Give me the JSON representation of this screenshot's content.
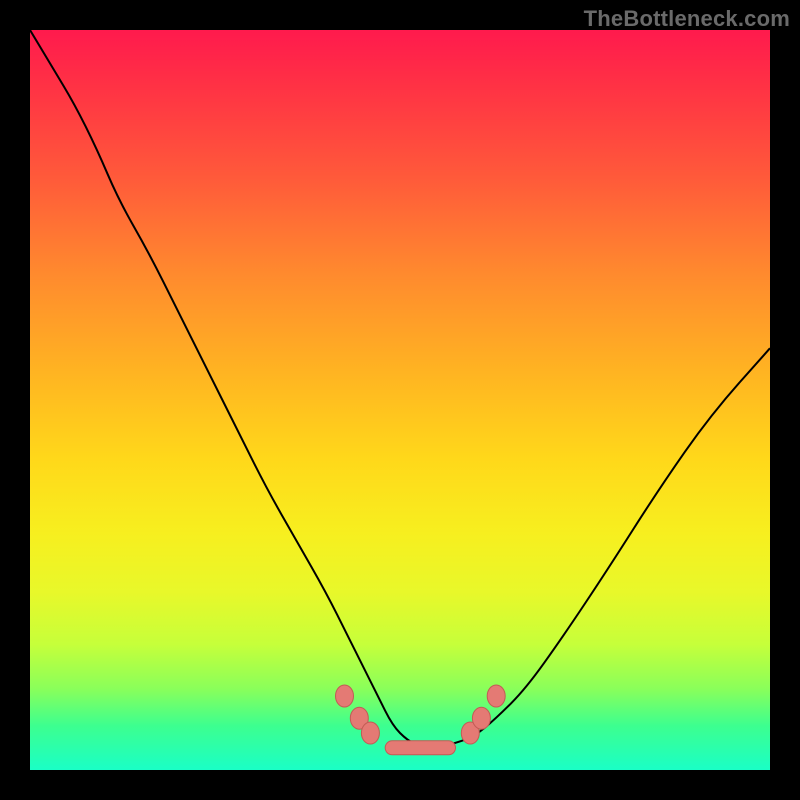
{
  "watermark": "TheBottleneck.com",
  "colors": {
    "dot_fill": "#e47a74",
    "dot_stroke": "#c25b55",
    "curve": "#000000",
    "frame": "#000000"
  },
  "chart_data": {
    "type": "line",
    "title": "",
    "xlabel": "",
    "ylabel": "",
    "xlim": [
      0,
      100
    ],
    "ylim": [
      0,
      100
    ],
    "grid": false,
    "legend": false,
    "series": [
      {
        "name": "bottleneck-curve",
        "x": [
          0,
          3,
          6,
          9,
          12,
          16,
          20,
          24,
          28,
          32,
          36,
          40,
          43,
          45,
          47,
          49,
          51,
          53,
          55,
          57,
          60,
          63,
          67,
          72,
          78,
          85,
          92,
          100
        ],
        "values": [
          100,
          95,
          90,
          84,
          77,
          70,
          62,
          54,
          46,
          38,
          31,
          24,
          18,
          14,
          10,
          6,
          4,
          3,
          3,
          3.5,
          4.5,
          7,
          11,
          18,
          27,
          38,
          48,
          57
        ]
      }
    ],
    "markers": [
      {
        "name": "left-cluster-1",
        "x": 42.5,
        "y": 10
      },
      {
        "name": "left-cluster-2",
        "x": 44.5,
        "y": 7
      },
      {
        "name": "left-cluster-3",
        "x": 46.0,
        "y": 5
      },
      {
        "name": "right-cluster-1",
        "x": 59.5,
        "y": 5
      },
      {
        "name": "right-cluster-2",
        "x": 61.0,
        "y": 7
      },
      {
        "name": "right-cluster-3",
        "x": 63.0,
        "y": 10
      }
    ],
    "flat_segment": {
      "x0": 48,
      "x1": 57.5,
      "y": 3
    }
  }
}
